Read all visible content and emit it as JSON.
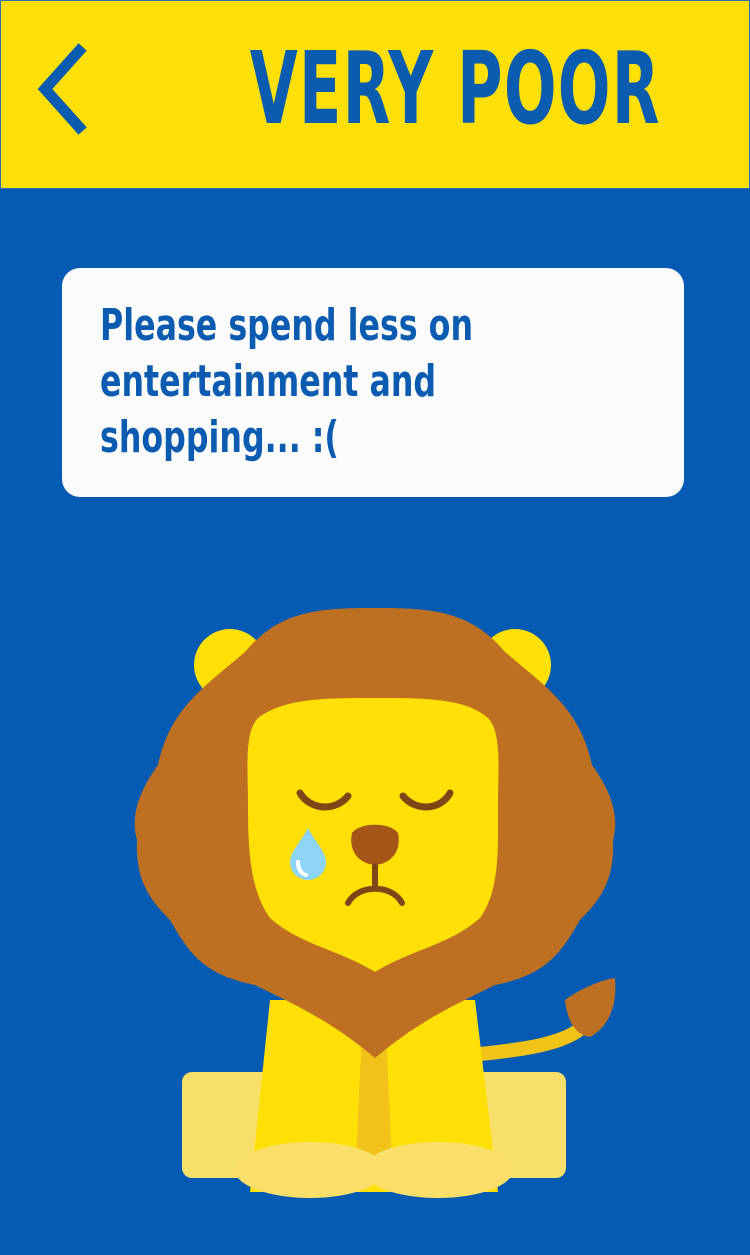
{
  "header": {
    "title": "VERY POOR",
    "back_icon": "chevron-left-icon"
  },
  "message": {
    "text": "Please spend less on\nentertainment and\nshopping... :("
  },
  "illustration": {
    "name": "sad-lion-illustration"
  },
  "colors": {
    "background": "#055bb4",
    "header": "#ffe006",
    "text": "#0b5bb0",
    "card": "#fbfbfc",
    "lion_body": "#ffe006",
    "lion_mane": "#bd7022"
  }
}
